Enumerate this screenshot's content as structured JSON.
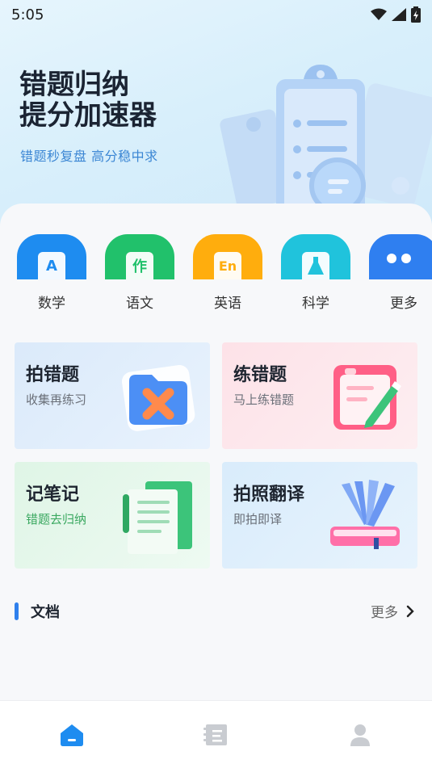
{
  "status_bar": {
    "time": "5:05"
  },
  "hero": {
    "title_line1": "错题归纳",
    "title_line2": "提分加速器",
    "subtitle": "错题秒复盘  高分稳中求"
  },
  "subjects": [
    {
      "label": "数学",
      "color": "#1e8cf0",
      "glyph": "A"
    },
    {
      "label": "语文",
      "color": "#21c16b",
      "glyph": "作"
    },
    {
      "label": "英语",
      "color": "#ffad0d",
      "glyph": "En"
    },
    {
      "label": "科学",
      "color": "#20c3dc",
      "glyph": ""
    },
    {
      "label": "更多",
      "color": "#2f7ff0",
      "glyph": ""
    }
  ],
  "features": [
    {
      "title": "拍错题",
      "desc": "收集再练习",
      "bg": "#dcecfb"
    },
    {
      "title": "练错题",
      "desc": "马上练错题",
      "bg": "#fde4ea"
    },
    {
      "title": "记笔记",
      "desc": "错题去归纳",
      "bg": "#e1f6e9"
    },
    {
      "title": "拍照翻译",
      "desc": "即拍即译",
      "bg": "#dceefb"
    }
  ],
  "documents": {
    "title": "文档",
    "more": "更多"
  },
  "bottom_nav": [
    "home-icon",
    "notebook-icon",
    "profile-icon"
  ],
  "colors": {
    "accent": "#2f80ed",
    "link": "#3b86d4"
  }
}
